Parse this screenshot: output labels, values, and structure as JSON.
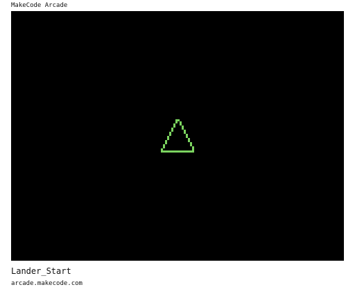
{
  "header": {
    "app_title": "MakeCode Arcade"
  },
  "game": {
    "background_color": "#000000",
    "sprite": {
      "name": "lander-ship",
      "color": "#7bd35f",
      "shape": "triangle-outline"
    }
  },
  "footer": {
    "game_name": "Lander_Start",
    "url": "arcade.makecode.com"
  }
}
